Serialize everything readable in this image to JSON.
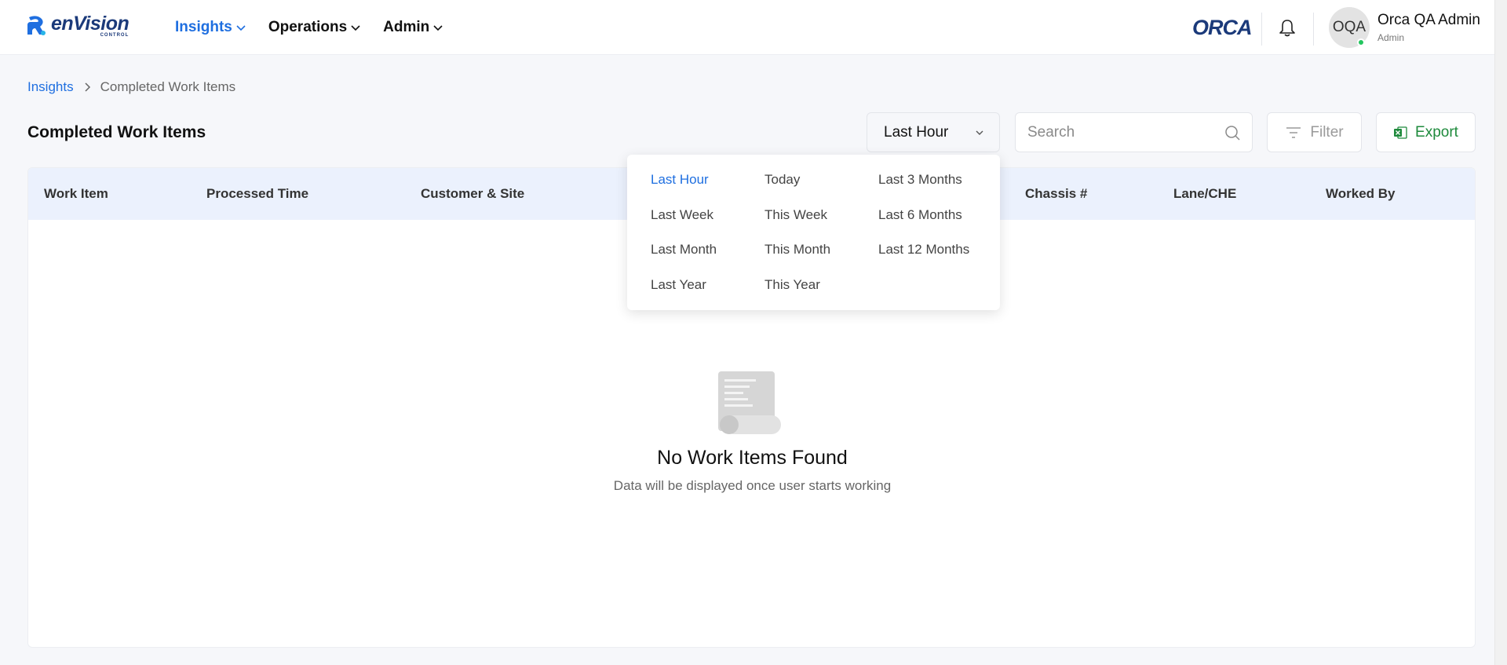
{
  "header": {
    "logo_text": "enVision",
    "logo_sub": "CONTROL",
    "nav": [
      {
        "label": "Insights",
        "active": true
      },
      {
        "label": "Operations",
        "active": false
      },
      {
        "label": "Admin",
        "active": false
      }
    ],
    "partner_logo": "ORCA",
    "user": {
      "initials": "OQA",
      "name": "Orca QA Admin",
      "role": "Admin",
      "status": "online"
    }
  },
  "breadcrumb": {
    "parent": "Insights",
    "current": "Completed Work Items"
  },
  "page": {
    "title": "Completed Work Items"
  },
  "toolbar": {
    "time_range": "Last Hour",
    "search_placeholder": "Search",
    "filter_label": "Filter",
    "export_label": "Export"
  },
  "table": {
    "columns": [
      "Work Item",
      "Processed Time",
      "Customer & Site",
      "",
      "Chassis #",
      "Lane/CHE",
      "Worked By"
    ],
    "empty": {
      "title": "No Work Items Found",
      "message": "Data will be displayed once user starts working"
    }
  },
  "dropdown": {
    "options": [
      [
        "Last Hour",
        "Today",
        "Last 3 Months"
      ],
      [
        "Last Week",
        "This Week",
        "Last 6 Months"
      ],
      [
        "Last Month",
        "This Month",
        "Last 12 Months"
      ],
      [
        "Last Year",
        "This Year"
      ]
    ],
    "selected": "Last Hour"
  },
  "colors": {
    "accent": "#1f6fe0",
    "brand": "#1b3a7a",
    "export": "#1e8a3c",
    "table_header": "#ebf1fd",
    "online": "#22c55e"
  }
}
